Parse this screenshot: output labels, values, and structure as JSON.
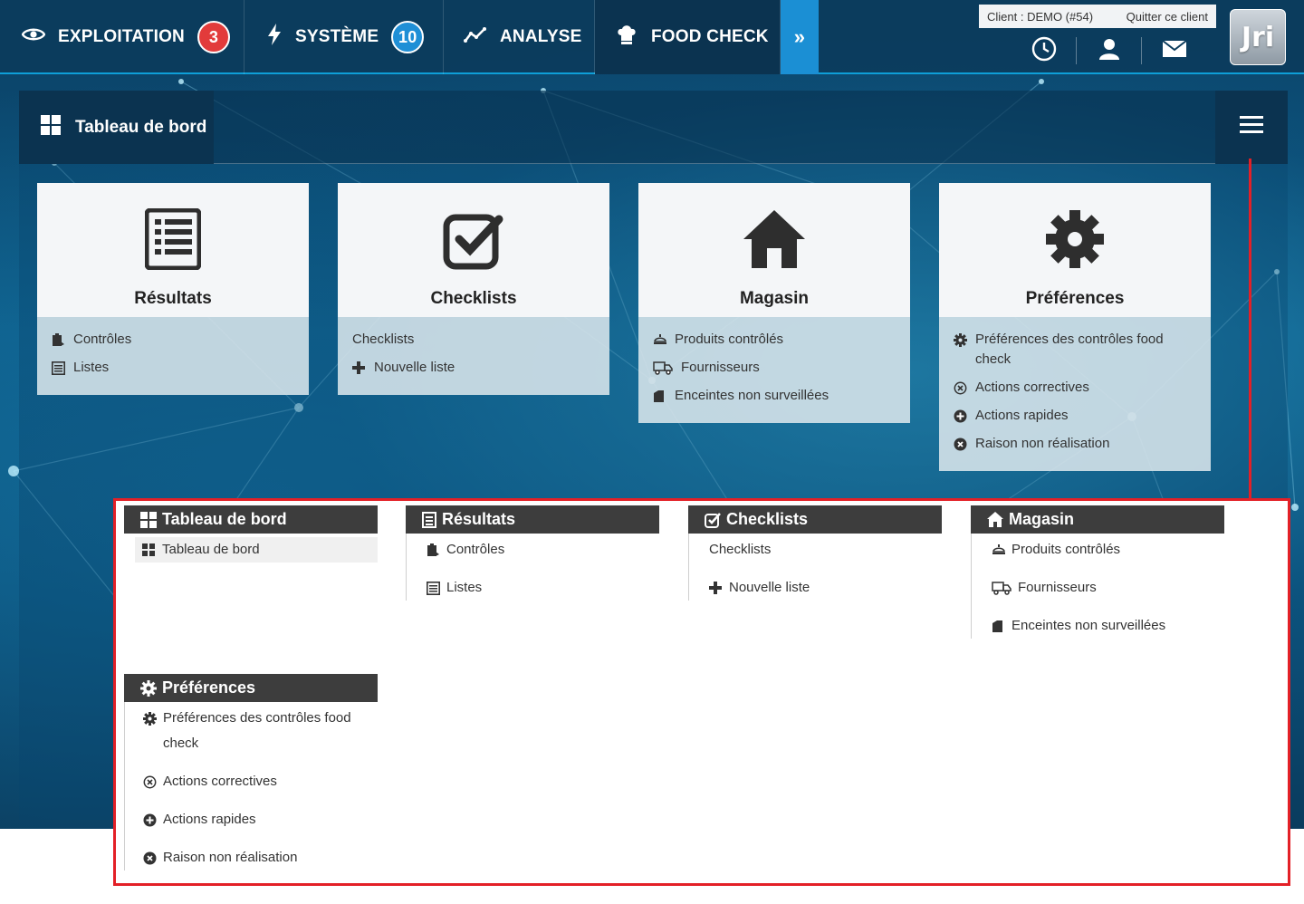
{
  "nav": {
    "exploitation": {
      "label": "EXPLOITATION",
      "badge": "3",
      "icon": "eye-icon"
    },
    "systeme": {
      "label": "SYSTÈME",
      "badge": "10",
      "icon": "lightning-icon"
    },
    "analyse": {
      "label": "ANALYSE",
      "icon": "line-chart-icon"
    },
    "foodcheck": {
      "label": "FOOD CHECK",
      "icon": "chef-hat-icon"
    },
    "more": {
      "label": "»"
    }
  },
  "client": {
    "label": "Client : DEMO (#54)",
    "quit_label": "Quitter ce client"
  },
  "logo_text": "Jri",
  "panel": {
    "title": "Tableau de bord"
  },
  "tiles": {
    "resultats": {
      "name": "Résultats",
      "links": [
        "Contrôles",
        "Listes"
      ]
    },
    "checklists": {
      "name": "Checklists",
      "links": [
        "Checklists",
        "Nouvelle liste"
      ]
    },
    "magasin": {
      "name": "Magasin",
      "links": [
        "Produits contrôlés",
        "Fournisseurs",
        "Enceintes non surveillées"
      ]
    },
    "preferences": {
      "name": "Préférences",
      "links": [
        "Préférences des contrôles food check",
        "Actions correctives",
        "Actions rapides",
        "Raison non réalisation"
      ]
    }
  },
  "menu": {
    "tableau": {
      "title": "Tableau de bord",
      "items": [
        "Tableau de bord"
      ]
    },
    "resultats": {
      "title": "Résultats",
      "items": [
        "Contrôles",
        "Listes"
      ]
    },
    "checklists": {
      "title": "Checklists",
      "items": [
        "Checklists",
        "Nouvelle liste"
      ]
    },
    "magasin": {
      "title": "Magasin",
      "items": [
        "Produits contrôlés",
        "Fournisseurs",
        "Enceintes non surveillées"
      ]
    },
    "preferences": {
      "title": "Préférences",
      "items": [
        "Préférences des contrôles food check",
        "Actions correctives",
        "Actions rapides",
        "Raison non réalisation"
      ]
    }
  },
  "colors": {
    "accent": "#1b8fd4",
    "badge_red": "#e23b3b",
    "highlight_red": "#e32027",
    "dark": "#0b3350"
  }
}
